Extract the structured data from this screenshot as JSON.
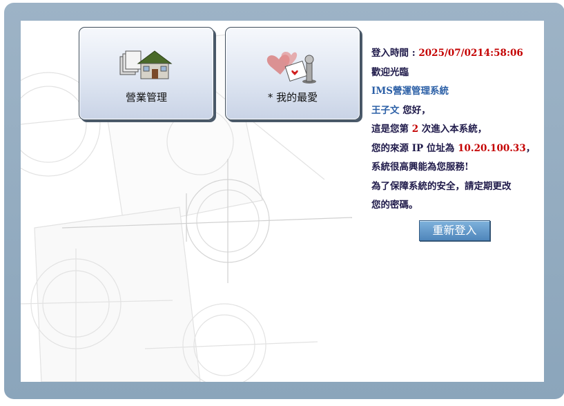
{
  "tiles": [
    {
      "label": "營業管理",
      "icon": "house-folders-icon"
    },
    {
      "label": "* 我的最愛",
      "icon": "heart-game-piece-icon"
    }
  ],
  "info": {
    "login_time_label": "登入時間 : ",
    "login_time_value": "2025/07/0214:58:06",
    "welcome": "歡迎光臨",
    "system_name": "IMS營運管理系統",
    "user_name": "王子文",
    "greeting": " 您好，",
    "visit_prefix": "這是您第 ",
    "visit_count": "2",
    "visit_suffix": " 次進入本系統，",
    "ip_prefix": "您的來源 IP 位址為 ",
    "ip_value": "10.20.100.33",
    "ip_suffix": "，",
    "service_text": "系統很高興能為您服務!",
    "security_line1": "為了保障系統的安全，請定期更改",
    "security_line2": "您的密碼。"
  },
  "relogin_button": "重新登入",
  "colors": {
    "frame": "#8ba5bb",
    "accent_red": "#c40000",
    "link_blue": "#2b5fa6",
    "text": "#1f1a4a"
  }
}
